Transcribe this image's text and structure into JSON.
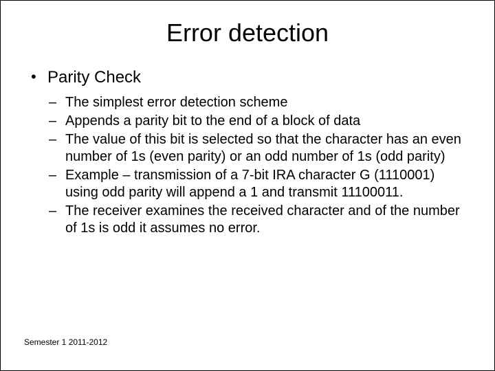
{
  "title": "Error detection",
  "l1": "Parity Check",
  "sub": [
    "The simplest error detection scheme",
    "Appends a parity bit to the end of a block of data",
    "The value of this bit is selected so that the character has an even number of 1s (even parity) or an odd number of 1s (odd parity)",
    "Example – transmission of a 7-bit IRA character G (1110001) using odd parity will append a 1 and transmit 11100011.",
    "The receiver examines the received character and of the number of 1s is odd it assumes no error."
  ],
  "footer": "Semester 1 2011-2012"
}
